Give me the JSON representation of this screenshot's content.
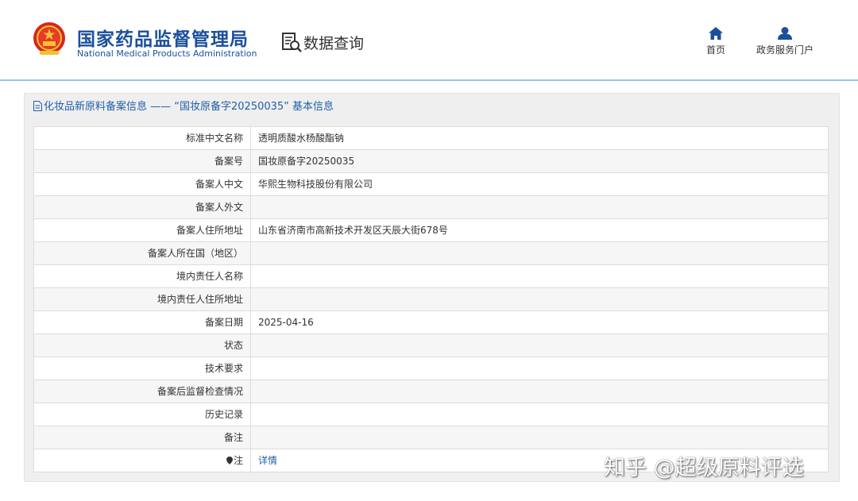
{
  "header": {
    "org_name_cn": "国家药品监督管理局",
    "org_name_en": "National Medical Products Administration",
    "section_label": "数据查询",
    "nav": [
      {
        "label": "首页",
        "icon": "home-icon"
      },
      {
        "label": "政务服务门户",
        "icon": "user-icon"
      }
    ]
  },
  "panel": {
    "title": "化妆品新原料备案信息 —— “国妆原备字20250035” 基本信息"
  },
  "rows": [
    {
      "label": "标准中文名称",
      "value": "透明质酸水杨酸酯钠"
    },
    {
      "label": "备案号",
      "value": "国妆原备字20250035"
    },
    {
      "label": "备案人中文",
      "value": "华熙生物科技股份有限公司"
    },
    {
      "label": "备案人外文",
      "value": ""
    },
    {
      "label": "备案人住所地址",
      "value": "山东省济南市高新技术开发区天辰大街678号"
    },
    {
      "label": "备案人所在国（地区）",
      "value": ""
    },
    {
      "label": "境内责任人名称",
      "value": ""
    },
    {
      "label": "境内责任人住所地址",
      "value": ""
    },
    {
      "label": "备案日期",
      "value": "2025-04-16"
    },
    {
      "label": "状态",
      "value": ""
    },
    {
      "label": "技术要求",
      "value": ""
    },
    {
      "label": "备案后监督检查情况",
      "value": ""
    },
    {
      "label": "历史记录",
      "value": ""
    },
    {
      "label": "备注",
      "value": ""
    },
    {
      "label": "注",
      "value": "详情"
    }
  ],
  "watermark": "知乎 @超级原料评选",
  "colors": {
    "brand_blue": "#1b4f9c",
    "link_blue": "#1f5fa8",
    "header_rule": "#9cc3e6"
  }
}
